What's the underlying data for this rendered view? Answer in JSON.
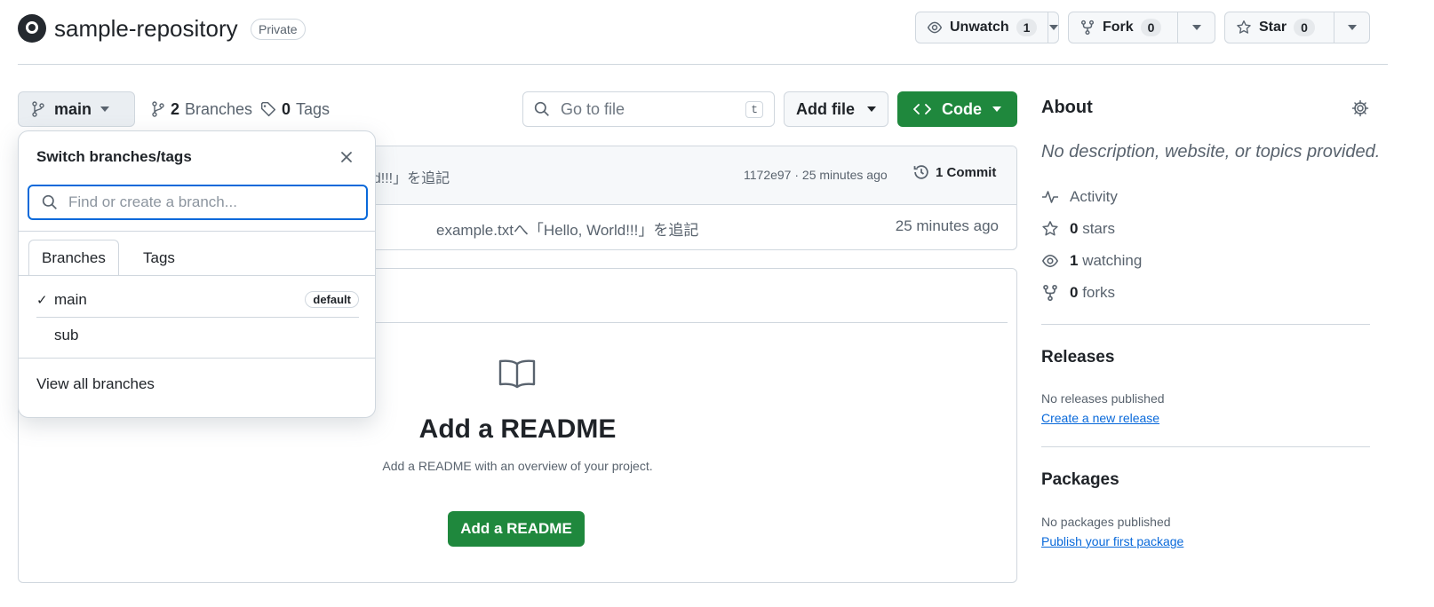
{
  "header": {
    "repo_name": "sample-repository",
    "visibility": "Private",
    "unwatch_label": "Unwatch",
    "unwatch_count": "1",
    "fork_label": "Fork",
    "fork_count": "0",
    "star_label": "Star",
    "star_count": "0"
  },
  "toolbar": {
    "branch": "main",
    "branches_count": "2",
    "branches_label": "Branches",
    "tags_count": "0",
    "tags_label": "Tags",
    "goto_placeholder": "Go to file",
    "goto_shortcut": "t",
    "add_file_label": "Add file",
    "code_label": "Code"
  },
  "commits": {
    "latest_message": "rld!!!」を追記",
    "hash_time": "1172e97 · 25 minutes ago",
    "commit_count_label": "1 Commit",
    "file_message": "example.txtへ「Hello, World!!!」を追記",
    "file_time": "25 minutes ago"
  },
  "readme": {
    "title": "Add a README",
    "subtitle": "Add a README with an overview of your project.",
    "button": "Add a README"
  },
  "about": {
    "title": "About",
    "description": "No description, website, or topics provided.",
    "activity": "Activity",
    "stars_count": "0",
    "stars_label": "stars",
    "watching_count": "1",
    "watching_label": "watching",
    "forks_count": "0",
    "forks_label": "forks"
  },
  "releases": {
    "title": "Releases",
    "note": "No releases published",
    "link": "Create a new release"
  },
  "packages": {
    "title": "Packages",
    "note": "No packages published",
    "link": "Publish your first package"
  },
  "branch_dropdown": {
    "title": "Switch branches/tags",
    "search_placeholder": "Find or create a branch...",
    "tabs": [
      "Branches",
      "Tags"
    ],
    "branches": [
      {
        "name": "main",
        "check": "✓",
        "badge": "default"
      },
      {
        "name": "sub"
      }
    ],
    "footer_link": "View all branches"
  },
  "colors": {
    "accent_blue": "#0969da",
    "primary_green": "#1f883d",
    "border": "#d0d7de",
    "muted_text": "#59636e"
  }
}
